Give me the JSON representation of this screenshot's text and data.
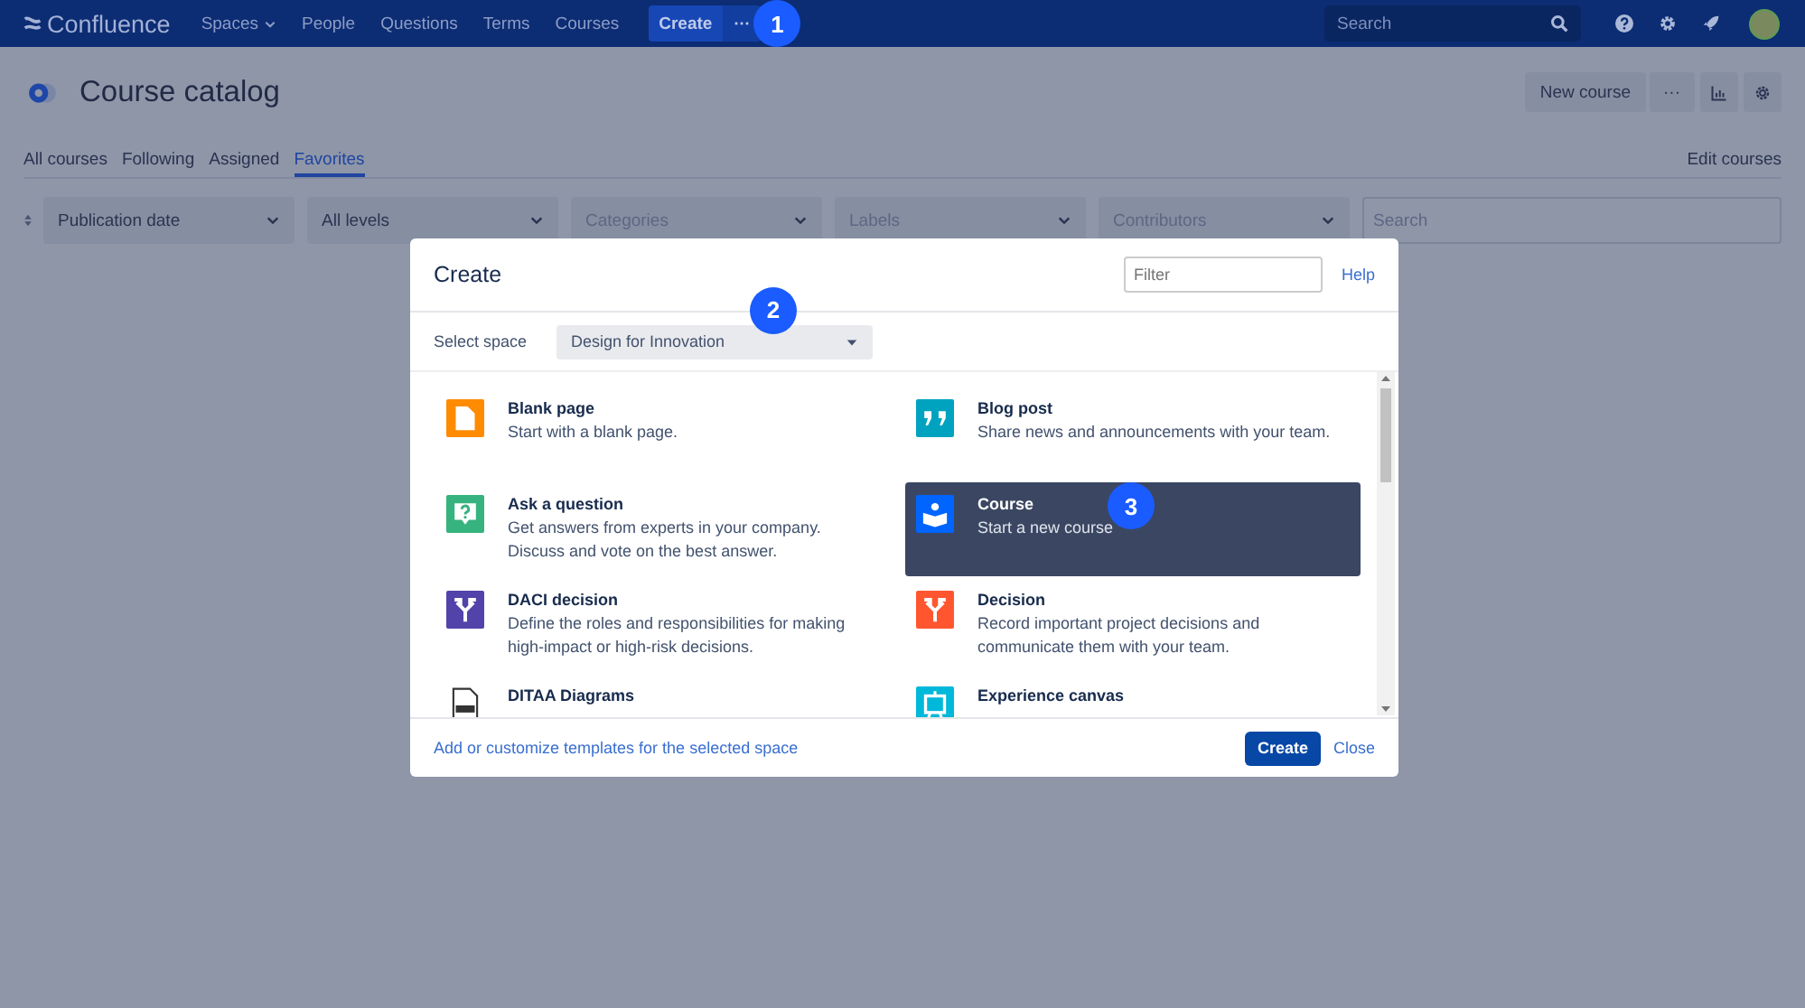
{
  "top_nav": {
    "logo": "Confluence",
    "items": [
      {
        "label": "Spaces",
        "dropdown": true
      },
      {
        "label": "People",
        "dropdown": false
      },
      {
        "label": "Questions",
        "dropdown": false
      },
      {
        "label": "Terms",
        "dropdown": false
      },
      {
        "label": "Courses",
        "dropdown": false
      }
    ],
    "create": "Create",
    "more": "···",
    "callout": "1",
    "search": {
      "placeholder": "Search"
    }
  },
  "header": {
    "title": "Course catalog",
    "buttons": [
      {
        "kind": "text",
        "label": "New course"
      },
      {
        "kind": "text",
        "label": "···"
      },
      {
        "kind": "chart"
      },
      {
        "kind": "settings"
      }
    ]
  },
  "tabs": [
    {
      "label": "All courses",
      "selected": false
    },
    {
      "label": "Following",
      "selected": false
    },
    {
      "label": "Assigned",
      "selected": false
    },
    {
      "label": "Favorites",
      "selected": true
    }
  ],
  "edit_link": "Edit courses",
  "filters": [
    {
      "kind": "select",
      "value": "Publication date"
    },
    {
      "kind": "select",
      "value": "All levels"
    },
    {
      "kind": "select",
      "placeholder": "Categories"
    },
    {
      "kind": "select",
      "placeholder": "Labels"
    },
    {
      "kind": "select",
      "placeholder": "Contributors"
    },
    {
      "kind": "search",
      "placeholder": "Search"
    }
  ],
  "dialog": {
    "title": "Create",
    "filter": {
      "placeholder": "Filter"
    },
    "help": "Help",
    "select_space": {
      "label": "Select space",
      "value": "Design for Innovation",
      "callout": "2"
    },
    "templates": [
      {
        "kind": "page",
        "color": "#ff8b00",
        "title": "Blank page",
        "description": "Start with a blank page.",
        "selected": false
      },
      {
        "kind": "quote",
        "color": "#00a3bf",
        "title": "Blog post",
        "description": "Share news and announcements with your team.",
        "selected": false
      },
      {
        "kind": "question",
        "color": "#36b37e",
        "title": "Ask a question",
        "description": "Get answers from experts in your company. Discuss and vote on the best answer.",
        "selected": false
      },
      {
        "kind": "course",
        "color": "#0065ff",
        "title": "Course",
        "description": "Start a new course",
        "selected": true,
        "callout": "3"
      },
      {
        "kind": "split",
        "color": "#5243aa",
        "title": "DACI decision",
        "description": "Define the roles and responsibilities for making high-impact or high-risk decisions.",
        "selected": false
      },
      {
        "kind": "split",
        "color": "#ff5630",
        "title": "Decision",
        "description": "Record important project decisions and communicate them with your team.",
        "selected": false
      },
      {
        "kind": "doc",
        "color": "#ffffff",
        "title": "DITAA Diagrams",
        "selected": false
      },
      {
        "kind": "canvas",
        "color": "#00b8d9",
        "title": "Experience canvas",
        "selected": false
      }
    ],
    "footer_link": "Add or customize templates for the selected space",
    "buttons": [
      {
        "kind": "primary",
        "label": "Create"
      },
      {
        "kind": "link",
        "label": "Close"
      }
    ]
  }
}
